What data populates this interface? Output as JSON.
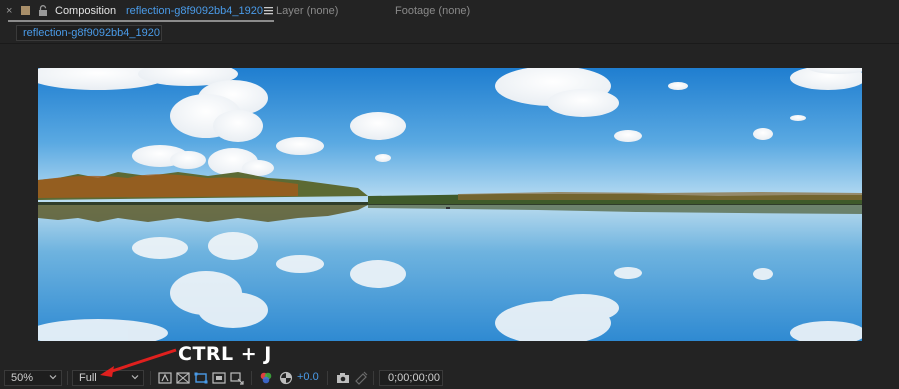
{
  "tabs": {
    "composition_label": "Composition",
    "composition_name": "reflection-g8f9092bb4_1920",
    "layer_label": "Layer (none)",
    "footage_label": "Footage (none)"
  },
  "breadcrumb": {
    "label": "reflection-g8f9092bb4_1920"
  },
  "icons": {
    "close": "×",
    "menu": "hamburger-menu-icon",
    "lock": "lock-icon",
    "swatch_color": "#a98f6a"
  },
  "toolbar": {
    "magnification": "50%",
    "resolution": "Full",
    "exposure": "+0.0",
    "timecode": "0;00;00;00"
  },
  "annotation": {
    "text": "CTRL + J",
    "color": "#e0201e"
  },
  "colors": {
    "accent_blue": "#4a9be8",
    "panel_bg": "#232323"
  }
}
